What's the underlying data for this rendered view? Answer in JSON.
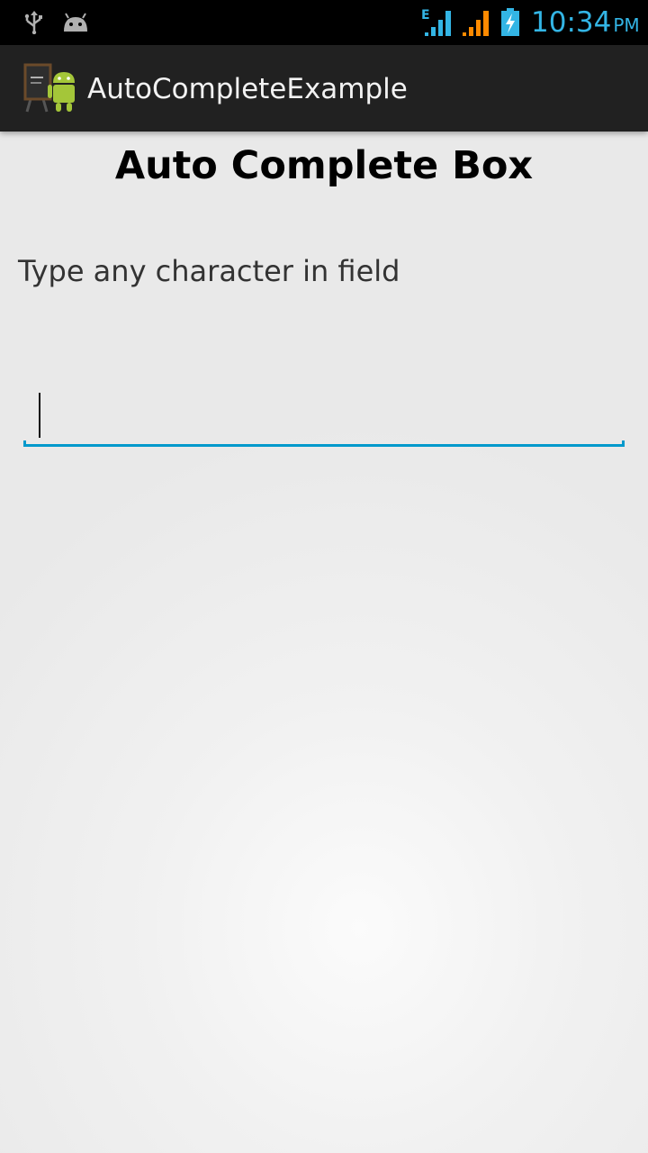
{
  "status_bar": {
    "time": "10:34",
    "ampm": "PM",
    "network_type": "E",
    "accent_color": "#33b5e5",
    "icons": [
      "usb-icon",
      "android-debug-icon",
      "signal-e-icon",
      "signal-orange-icon",
      "battery-charging-icon"
    ]
  },
  "action_bar": {
    "app_icon": "android-blackboard-icon",
    "title": "AutoCompleteExample"
  },
  "main": {
    "heading": "Auto Complete Box",
    "instruction": "Type any character in field",
    "input": {
      "value": "",
      "placeholder": "",
      "focused": true,
      "underline_color": "#0099cc"
    }
  }
}
